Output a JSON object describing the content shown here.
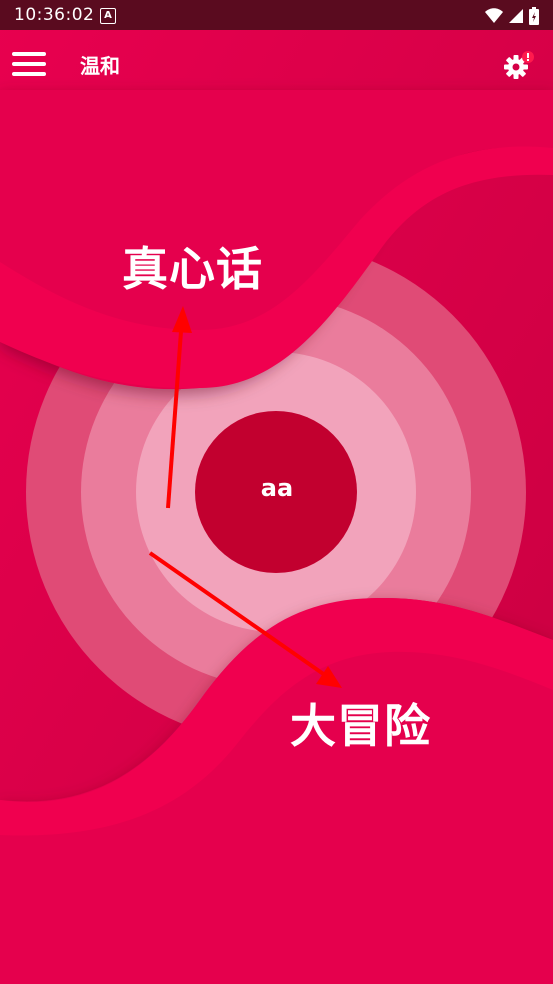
{
  "status_bar": {
    "time": "10:36:02",
    "notification_icon": "A",
    "icons": [
      "wifi-icon",
      "signal-icon",
      "battery-icon"
    ]
  },
  "app_bar": {
    "title": "温和",
    "menu_icon": "hamburger-menu-icon",
    "settings_icon": "settings-alert-icon"
  },
  "main": {
    "truth_label": "真心话",
    "dare_label": "大冒险",
    "center_text": "aa"
  },
  "colors": {
    "background": "#d40046",
    "wave": "#f0004f",
    "center_circle": "#c2002f",
    "ring_inner": "#f2a3bb",
    "ring_mid": "#ea7c9c",
    "ring_outer": "#e04b76",
    "arrow": "#ff0000",
    "status_bar": "#5a0b1f"
  }
}
